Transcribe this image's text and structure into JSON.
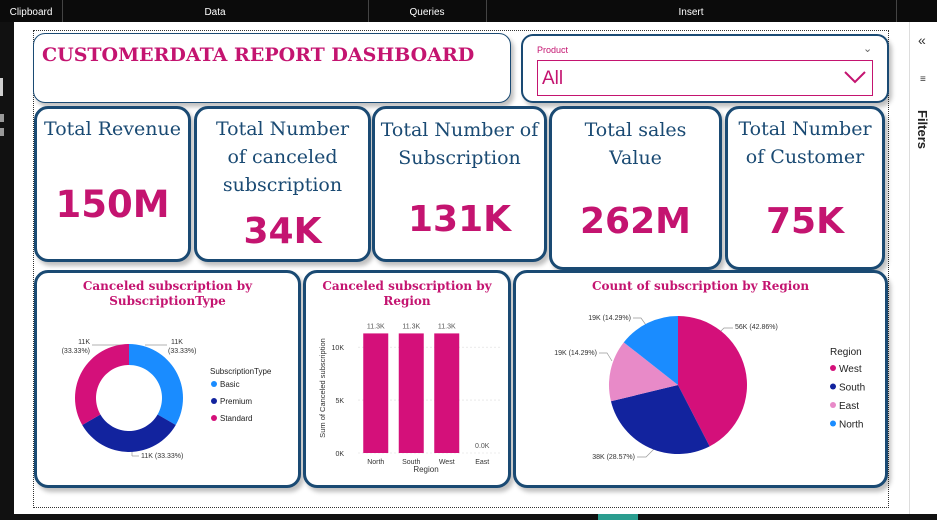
{
  "ribbon": {
    "tabs": [
      {
        "label": "Clipboard"
      },
      {
        "label": "Data"
      },
      {
        "label": "Queries"
      },
      {
        "label": "Insert"
      }
    ]
  },
  "filters_pane": {
    "label": "Filters"
  },
  "dashboard": {
    "title": "CUSTOMERDATA REPORT DASHBOARD",
    "slicer": {
      "label": "Product",
      "value": "All"
    }
  },
  "kpis": [
    {
      "label_lines": [
        "Total Revenue"
      ],
      "value": "150M"
    },
    {
      "label_lines": [
        "Total Number",
        "of canceled",
        "subscription"
      ],
      "value": "34K"
    },
    {
      "label_lines": [
        "Total Number of",
        "Subscription"
      ],
      "value": "131K"
    },
    {
      "label_lines": [
        "Total sales",
        "Value"
      ],
      "value": "262M"
    },
    {
      "label_lines": [
        "Total Number",
        "of Customer"
      ],
      "value": "75K"
    }
  ],
  "chart_data": [
    {
      "type": "pie",
      "variant": "donut",
      "title_lines": [
        "Canceled subscription by",
        "SubscriptionType"
      ],
      "legend_title": "SubscriptionType",
      "categories": [
        "Basic",
        "Premium",
        "Standard"
      ],
      "values": [
        11,
        11,
        11
      ],
      "data_labels": [
        "11K",
        "(33.33%)",
        "11K",
        "(33.33%)",
        "11K (33.33%)"
      ],
      "colors": [
        "#1a8cff",
        "#12239e",
        "#d4107a"
      ],
      "legend_position": "right"
    },
    {
      "type": "bar",
      "title_lines": [
        "Canceled subscription by",
        "Region"
      ],
      "categories": [
        "North",
        "South",
        "West",
        "East"
      ],
      "values": [
        11.3,
        11.3,
        11.3,
        0
      ],
      "data_labels": [
        "11.3K",
        "11.3K",
        "11.3K",
        "0.0K"
      ],
      "ylabel": "Sum of Canceled subscription",
      "xlabel": "Region",
      "yticks": [
        "0K",
        "5K",
        "10K"
      ],
      "ylim": [
        0,
        12
      ],
      "grid": true,
      "color": "#d4107a"
    },
    {
      "type": "pie",
      "title_lines": [
        "Count of subscription by Region"
      ],
      "legend_title": "Region",
      "categories": [
        "West",
        "South",
        "East",
        "North"
      ],
      "values": [
        56,
        38,
        19,
        19
      ],
      "data_labels": [
        "56K (42.86%)",
        "38K (28.57%)",
        "19K (14.29%)",
        "19K (14.29%)"
      ],
      "colors": [
        "#d4107a",
        "#12239e",
        "#e88ac8",
        "#1a8cff"
      ],
      "legend_position": "right"
    }
  ]
}
